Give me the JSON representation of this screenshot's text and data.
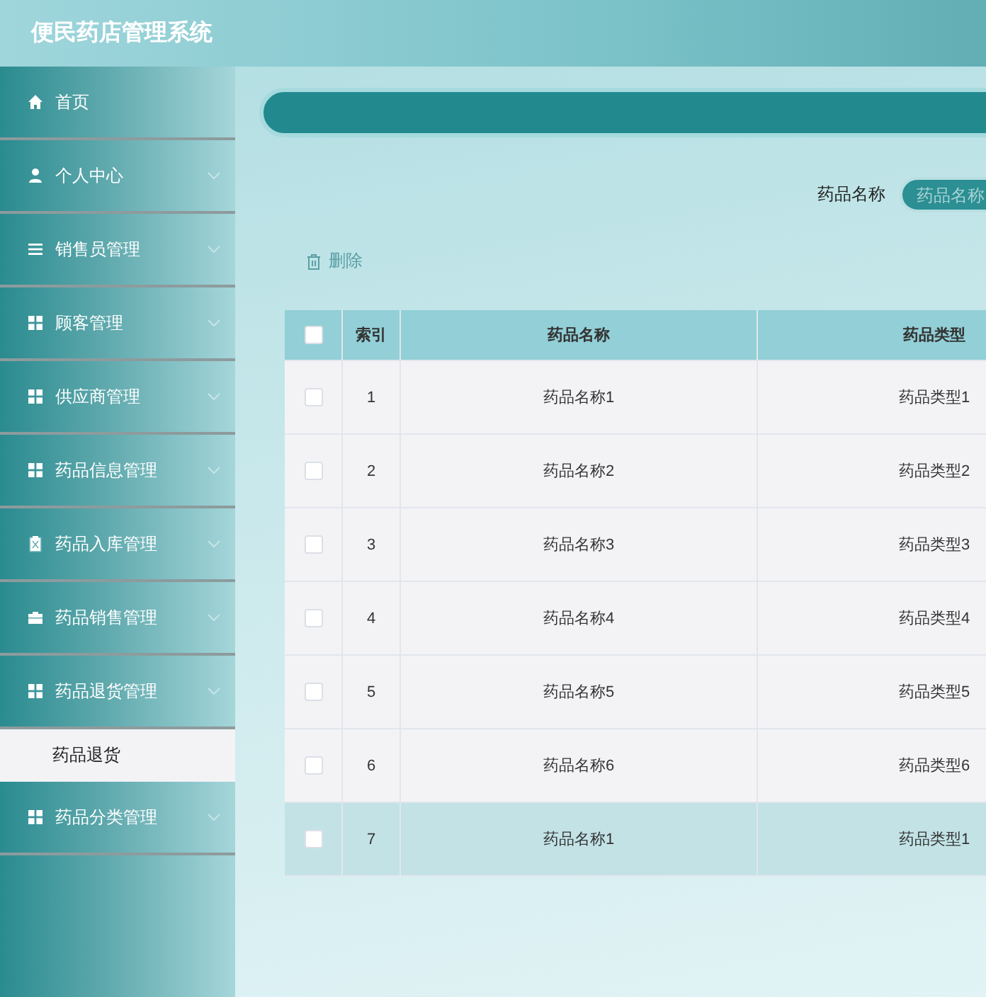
{
  "header": {
    "title": "便民药店管理系统"
  },
  "sidebar": {
    "items": [
      {
        "label": "首页",
        "expandable": false
      },
      {
        "label": "个人中心",
        "expandable": true
      },
      {
        "label": "销售员管理",
        "expandable": true
      },
      {
        "label": "顾客管理",
        "expandable": true
      },
      {
        "label": "供应商管理",
        "expandable": true
      },
      {
        "label": "药品信息管理",
        "expandable": true
      },
      {
        "label": "药品入库管理",
        "expandable": true
      },
      {
        "label": "药品销售管理",
        "expandable": true
      },
      {
        "label": "药品退货管理",
        "expandable": true,
        "children": [
          {
            "label": "药品退货",
            "selected": true
          }
        ]
      },
      {
        "label": "药品分类管理",
        "expandable": true
      }
    ]
  },
  "search": {
    "label": "药品名称",
    "placeholder": "药品名称"
  },
  "actions": {
    "delete": "删除"
  },
  "table": {
    "columns": [
      "索引",
      "药品名称",
      "药品类型"
    ],
    "all_checked": false,
    "rows": [
      {
        "checked": false,
        "highlighted": false,
        "cells": [
          "1",
          "药品名称1",
          "药品类型1"
        ]
      },
      {
        "checked": false,
        "highlighted": false,
        "cells": [
          "2",
          "药品名称2",
          "药品类型2"
        ]
      },
      {
        "checked": false,
        "highlighted": false,
        "cells": [
          "3",
          "药品名称3",
          "药品类型3"
        ]
      },
      {
        "checked": false,
        "highlighted": false,
        "cells": [
          "4",
          "药品名称4",
          "药品类型4"
        ]
      },
      {
        "checked": false,
        "highlighted": false,
        "cells": [
          "5",
          "药品名称5",
          "药品类型5"
        ]
      },
      {
        "checked": false,
        "highlighted": false,
        "cells": [
          "6",
          "药品名称6",
          "药品类型6"
        ]
      },
      {
        "checked": false,
        "highlighted": true,
        "cells": [
          "7",
          "药品名称1",
          "药品类型1"
        ]
      }
    ]
  }
}
